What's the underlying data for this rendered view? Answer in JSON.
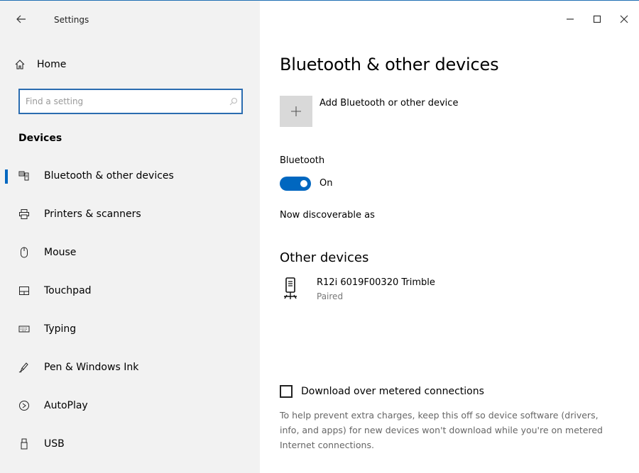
{
  "window": {
    "title": "Settings",
    "accent_color": "#0067c0"
  },
  "sidebar": {
    "home_label": "Home",
    "search_placeholder": "Find a setting",
    "section_title": "Devices",
    "items": [
      {
        "label": "Bluetooth & other devices",
        "icon": "bluetooth-devices-icon",
        "active": true
      },
      {
        "label": "Printers & scanners",
        "icon": "printer-icon",
        "active": false
      },
      {
        "label": "Mouse",
        "icon": "mouse-icon",
        "active": false
      },
      {
        "label": "Touchpad",
        "icon": "touchpad-icon",
        "active": false
      },
      {
        "label": "Typing",
        "icon": "keyboard-icon",
        "active": false
      },
      {
        "label": "Pen & Windows Ink",
        "icon": "pen-icon",
        "active": false
      },
      {
        "label": "AutoPlay",
        "icon": "autoplay-icon",
        "active": false
      },
      {
        "label": "USB",
        "icon": "usb-icon",
        "active": false
      }
    ]
  },
  "main": {
    "title": "Bluetooth & other devices",
    "add_device_label": "Add Bluetooth or other device",
    "bluetooth_label": "Bluetooth",
    "bluetooth_state": "On",
    "discoverable_text": "Now discoverable as",
    "other_devices_title": "Other devices",
    "devices": [
      {
        "name": "R12i  6019F00320  Trimble",
        "status": "Paired",
        "icon": "gps-receiver-icon"
      }
    ],
    "metered_label": "Download over metered connections",
    "metered_checked": false,
    "metered_help": "To help prevent extra charges, keep this off so device software (drivers, info, and apps) for new devices won't download while you're on metered Internet connections."
  }
}
